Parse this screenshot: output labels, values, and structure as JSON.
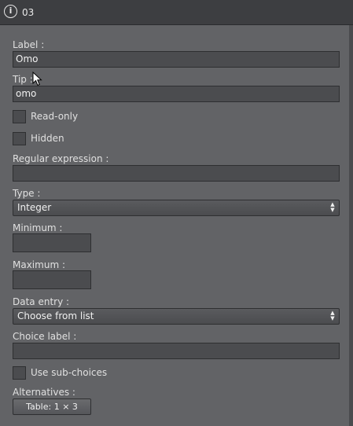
{
  "window": {
    "title": "03",
    "icon": "info-icon"
  },
  "form": {
    "label": {
      "caption": "Label :",
      "value": "Omo"
    },
    "tip": {
      "caption": "Tip :",
      "value": "omo"
    },
    "read_only": {
      "caption": "Read-only",
      "checked": false
    },
    "hidden": {
      "caption": "Hidden",
      "checked": false
    },
    "regex": {
      "caption": "Regular expression :",
      "value": ""
    },
    "type": {
      "caption": "Type :",
      "value": "Integer"
    },
    "minimum": {
      "caption": "Minimum :",
      "value": ""
    },
    "maximum": {
      "caption": "Maximum :",
      "value": ""
    },
    "data_entry": {
      "caption": "Data entry :",
      "value": "Choose from list"
    },
    "choice_label": {
      "caption": "Choice label :",
      "value": ""
    },
    "sub_choices": {
      "caption": "Use sub-choices",
      "checked": false
    },
    "alternatives": {
      "caption": "Alternatives :",
      "button": "Table: 1 × 3"
    }
  }
}
